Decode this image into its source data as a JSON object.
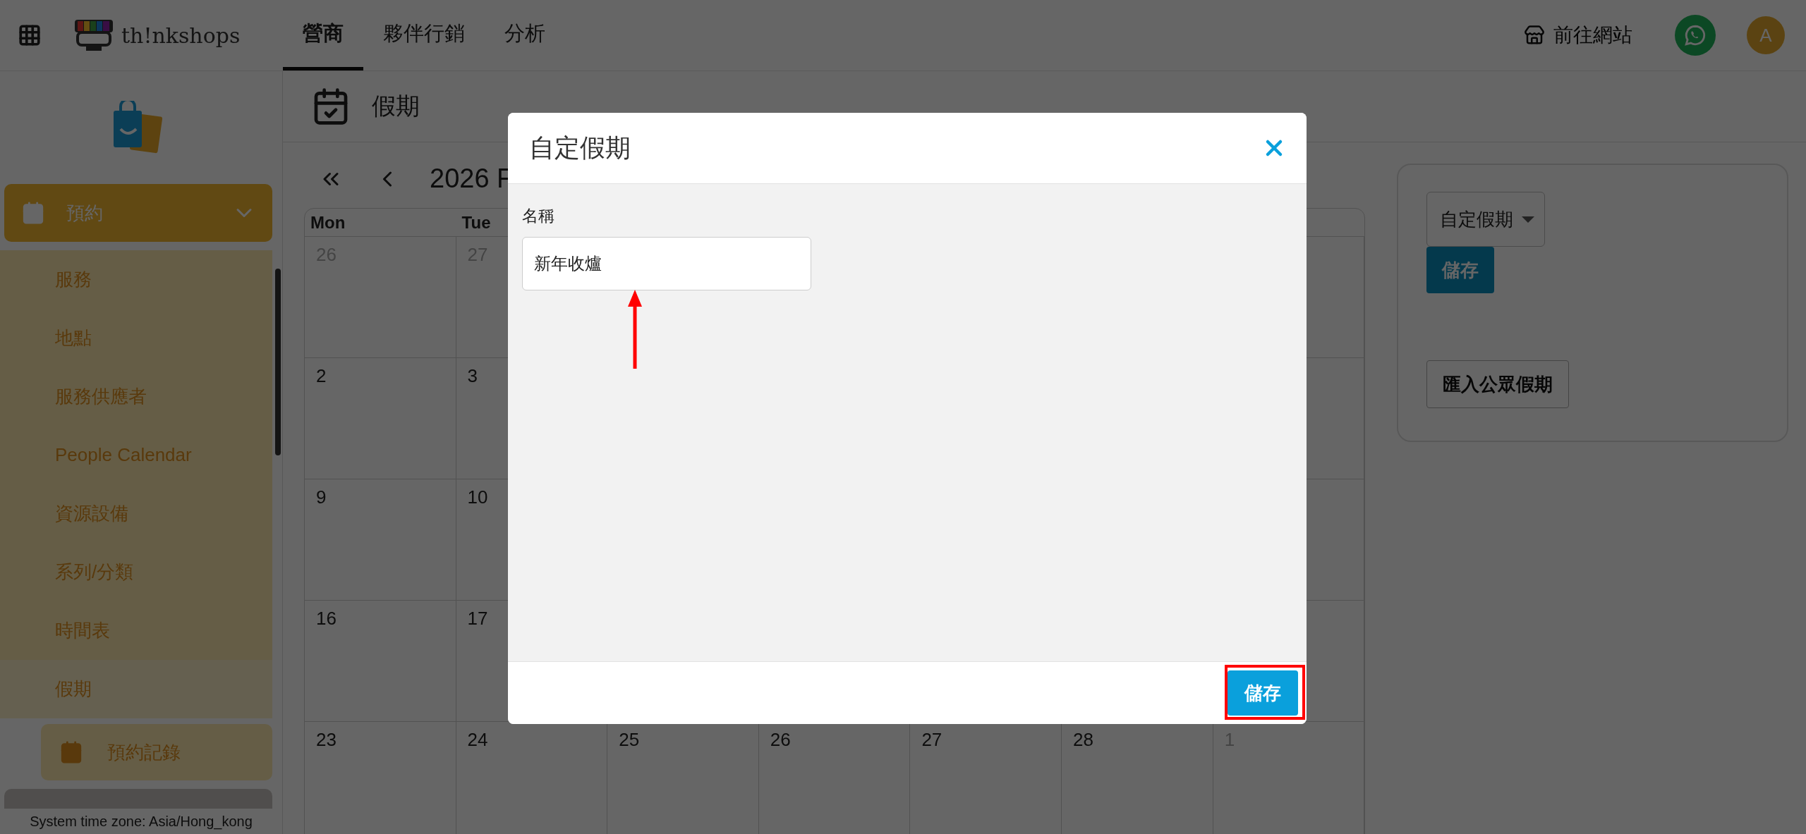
{
  "topbar": {
    "logo": "th!nkshops",
    "tabs": [
      {
        "label": "營商",
        "selected": true
      },
      {
        "label": "夥伴行銷",
        "selected": false
      },
      {
        "label": "分析",
        "selected": false
      }
    ],
    "visit_site": "前往網站",
    "avatar": "A"
  },
  "sidebar": {
    "group": {
      "label": "預約",
      "expanded": true,
      "items": [
        {
          "label": "服務",
          "selected": false
        },
        {
          "label": "地點",
          "selected": false
        },
        {
          "label": "服務供應者",
          "selected": false
        },
        {
          "label": "People Calendar",
          "selected": false
        },
        {
          "label": "資源設備",
          "selected": false
        },
        {
          "label": "系列/分類",
          "selected": false
        },
        {
          "label": "時間表",
          "selected": false
        },
        {
          "label": "假期",
          "selected": true
        }
      ]
    },
    "next_item": "預約記錄",
    "footer": "System time zone: Asia/Hong_kong"
  },
  "page": {
    "title": "假期"
  },
  "calendar": {
    "month_label": "2026 F",
    "weekdays": [
      "Mon",
      "Tue"
    ],
    "weeks": [
      [
        {
          "day": "26",
          "muted": true
        },
        {
          "day": "27",
          "muted": true
        }
      ],
      [
        {
          "day": "2",
          "muted": false
        },
        {
          "day": "3",
          "muted": false
        }
      ],
      [
        {
          "day": "9",
          "muted": false
        },
        {
          "day": "10",
          "muted": false
        }
      ],
      [
        {
          "day": "16",
          "muted": false
        },
        {
          "day": "17",
          "muted": false
        }
      ],
      [
        {
          "day": "23",
          "muted": false
        },
        {
          "day": "24",
          "muted": false
        },
        {
          "day": "25",
          "muted": false
        },
        {
          "day": "26",
          "muted": false
        },
        {
          "day": "27",
          "muted": false
        },
        {
          "day": "28",
          "muted": false
        },
        {
          "day": "1",
          "muted": true
        }
      ]
    ]
  },
  "side_panel": {
    "select_value": "自定假期",
    "save": "儲存",
    "import": "匯入公眾假期"
  },
  "dialog": {
    "title": "自定假期",
    "field_label": "名稱",
    "field_value": "新年收爐",
    "save": "儲存"
  },
  "annotations": {
    "arrow": {
      "color": "#ff0000"
    },
    "highlight": {
      "color": "#ff0000"
    }
  }
}
